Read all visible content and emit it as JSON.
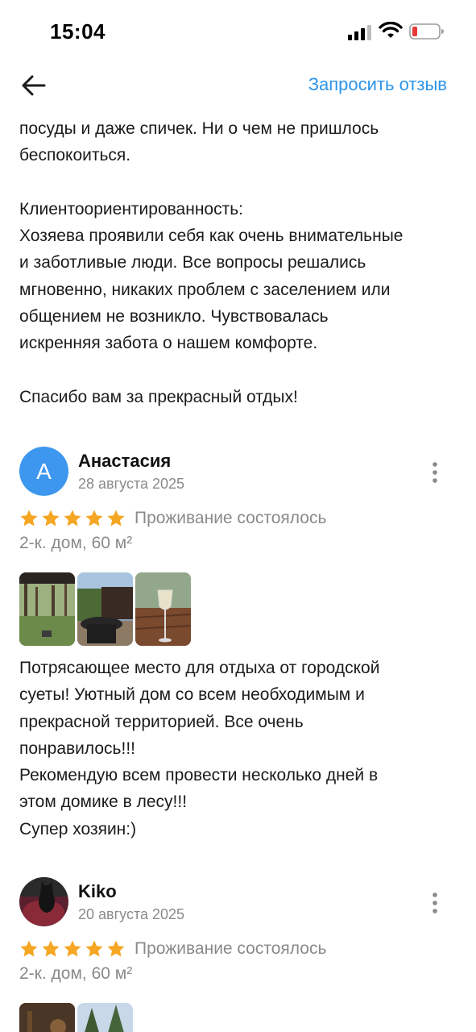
{
  "status_bar": {
    "time": "15:04"
  },
  "nav": {
    "back_icon": "arrow-left-icon",
    "request_review_label": "Запросить отзыв"
  },
  "previous_review": {
    "text": "посуды и даже спичек. Ни о чем не пришлось\nбеспокоиться.\n\nКлиентоориентированность:\nХозяева проявили себя как очень внимательные\nи заботливые люди. Все вопросы решались\nмгновенно, никаких проблем с заселением или\nобщением не возникло. Чувствовалась\nискренняя забота о нашем комфорте.\n\nСпасибо вам за прекрасный отдых!"
  },
  "reviews": [
    {
      "avatar_letter": "A",
      "avatar_color": "#3d97ee",
      "author": "Анастасия",
      "date": "28 августа 2025",
      "rating": 5,
      "stay_status": "Проживание состоялось",
      "listing": "2-к. дом, 60 м²",
      "photos": [
        "forest-yard-photo",
        "fire-pit-photo",
        "wine-glass-photo"
      ],
      "text": "Потрясающее место для отдыха от городской\nсуеты! Уютный дом со всем необходимым и\nпрекрасной территорией. Все очень\nпонравилось!!!\nРекомендую всем провести несколько дней в\nэтом домике в лесу!!!\nСупер хозяин:)"
    },
    {
      "avatar_color": "#5a2030",
      "author": "Kiko",
      "date": "20 августа 2025",
      "rating": 5,
      "stay_status": "Проживание состоялось",
      "listing": "2-к. дом, 60 м²",
      "photos": [
        "night-photo",
        "trees-photo"
      ]
    }
  ],
  "colors": {
    "accent": "#2b94ea",
    "star": "#f5a623",
    "secondary_text": "#8a8a8a"
  }
}
